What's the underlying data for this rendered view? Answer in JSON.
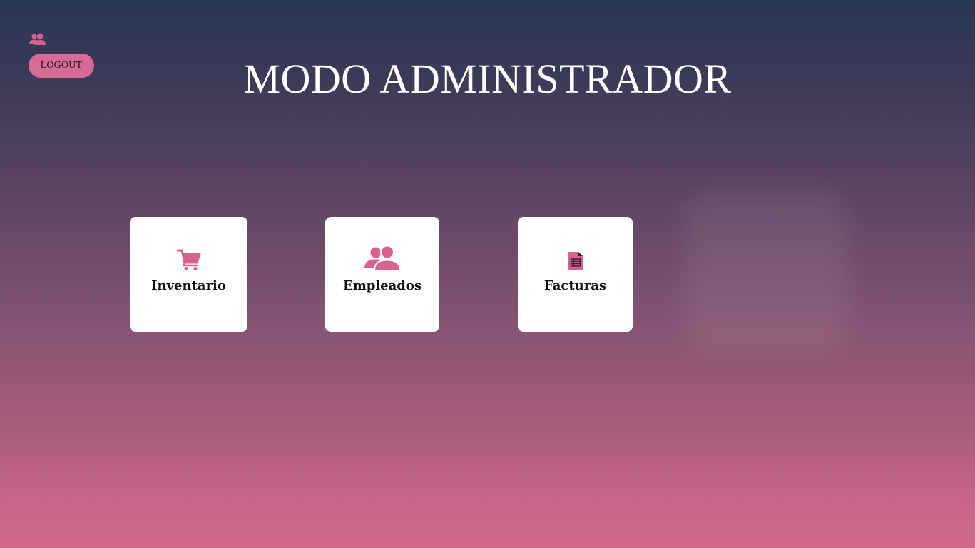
{
  "header": {
    "title": "MODO ADMINISTRADOR",
    "logout_label": "LOGOUT",
    "user_icon": "users-icon"
  },
  "cards": [
    {
      "label": "Inventario",
      "icon": "shopping-cart-icon"
    },
    {
      "label": "Empleados",
      "icon": "users-icon"
    },
    {
      "label": "Facturas",
      "icon": "spreadsheet-file-icon"
    }
  ],
  "colors": {
    "accent": "#d86b95",
    "icon": "#d8628f",
    "background_top": "#283752",
    "background_bottom": "#d0688c",
    "card": "#ffffff"
  }
}
